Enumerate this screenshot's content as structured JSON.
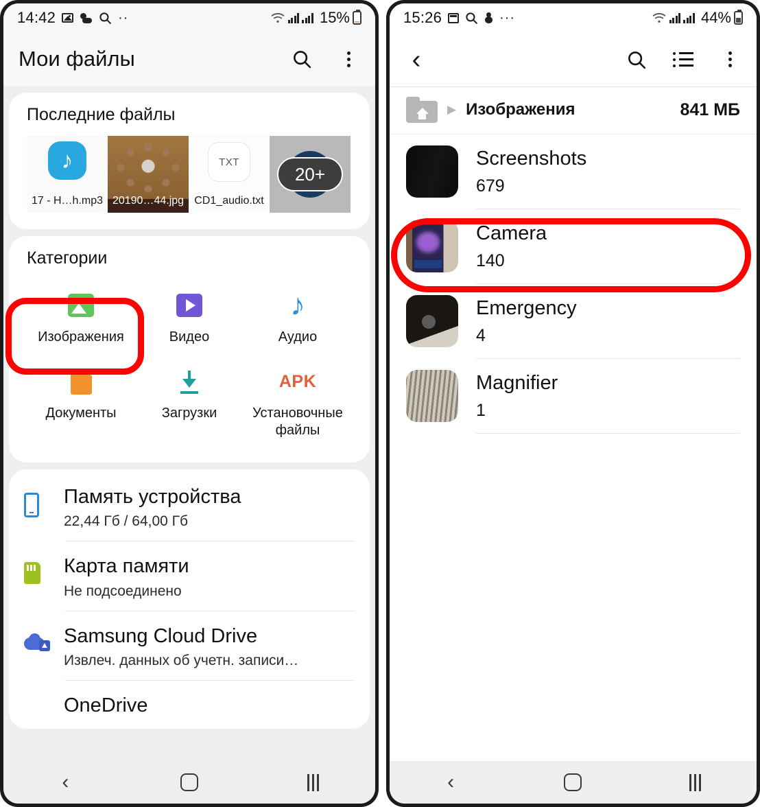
{
  "left_phone": {
    "status_bar": {
      "time": "14:42",
      "icons": [
        "photo-icon",
        "weather-icon",
        "search-icon",
        "more-dots-icon"
      ],
      "battery_percent": "15%",
      "signal": "wifi-icon"
    },
    "app_bar": {
      "title": "Мои файлы",
      "search_label": "search-icon",
      "menu_label": "kebab-menu-icon"
    },
    "recent_files": {
      "title": "Последние файлы",
      "items": [
        {
          "name": "17 - H…h.mp3",
          "kind": "audio"
        },
        {
          "name": "20190…44.jpg",
          "kind": "image"
        },
        {
          "name": "CD1_audio.txt",
          "kind": "text",
          "badge": "TXT"
        },
        {
          "name": "",
          "kind": "more",
          "badge": "20+"
        }
      ]
    },
    "categories": {
      "title": "Категории",
      "items": [
        {
          "label": "Изображения",
          "icon": "image-icon",
          "color": "#5ec65a"
        },
        {
          "label": "Видео",
          "icon": "video-icon",
          "color": "#7256d8"
        },
        {
          "label": "Аудио",
          "icon": "audio-note-icon",
          "color": "#2f8fe0"
        },
        {
          "label": "Документы",
          "icon": "document-icon",
          "color": "#f3912f"
        },
        {
          "label": "Загрузки",
          "icon": "download-icon",
          "color": "#1f9e9e"
        },
        {
          "label": "Установочные файлы",
          "icon": "apk-icon",
          "color": "#e0603c"
        }
      ]
    },
    "storage": [
      {
        "title": "Память устройства",
        "subtitle": "22,44 Гб / 64,00 Гб",
        "icon": "phone-icon"
      },
      {
        "title": "Карта памяти",
        "subtitle": "Не подсоединено",
        "icon": "sd-card-icon"
      },
      {
        "title": "Samsung Cloud Drive",
        "subtitle": "Извлеч. данных об учетн. записи…",
        "icon": "cloud-icon"
      },
      {
        "title": "OneDrive",
        "subtitle": "",
        "icon": "onedrive-icon"
      }
    ],
    "nav_bar": {
      "back": "back-icon",
      "home": "home-icon",
      "recents": "recents-icon"
    }
  },
  "right_phone": {
    "status_bar": {
      "time": "15:26",
      "icons": [
        "calendar-icon",
        "search-icon",
        "snowman-icon",
        "more-dots-icon"
      ],
      "battery_percent": "44%",
      "signal": "wifi-icon"
    },
    "app_bar": {
      "back_label": "back-chevron-icon",
      "search_label": "search-icon",
      "view_label": "list-view-icon",
      "menu_label": "kebab-menu-icon"
    },
    "breadcrumb": {
      "home": "folder-home-icon",
      "separator": "▶",
      "path": "Изображения",
      "size": "841 МБ"
    },
    "folders": [
      {
        "name": "Screenshots",
        "count": "679",
        "thumb": "screenshots-thumb"
      },
      {
        "name": "Camera",
        "count": "140",
        "thumb": "camera-thumb"
      },
      {
        "name": "Emergency",
        "count": "4",
        "thumb": "emergency-thumb"
      },
      {
        "name": "Magnifier",
        "count": "1",
        "thumb": "magnifier-thumb"
      }
    ],
    "nav_bar": {
      "back": "back-icon",
      "home": "home-icon",
      "recents": "recents-icon"
    }
  },
  "annotations": {
    "highlight_color": "#fb0400",
    "targets": [
      "Изображения",
      "Camera"
    ]
  }
}
